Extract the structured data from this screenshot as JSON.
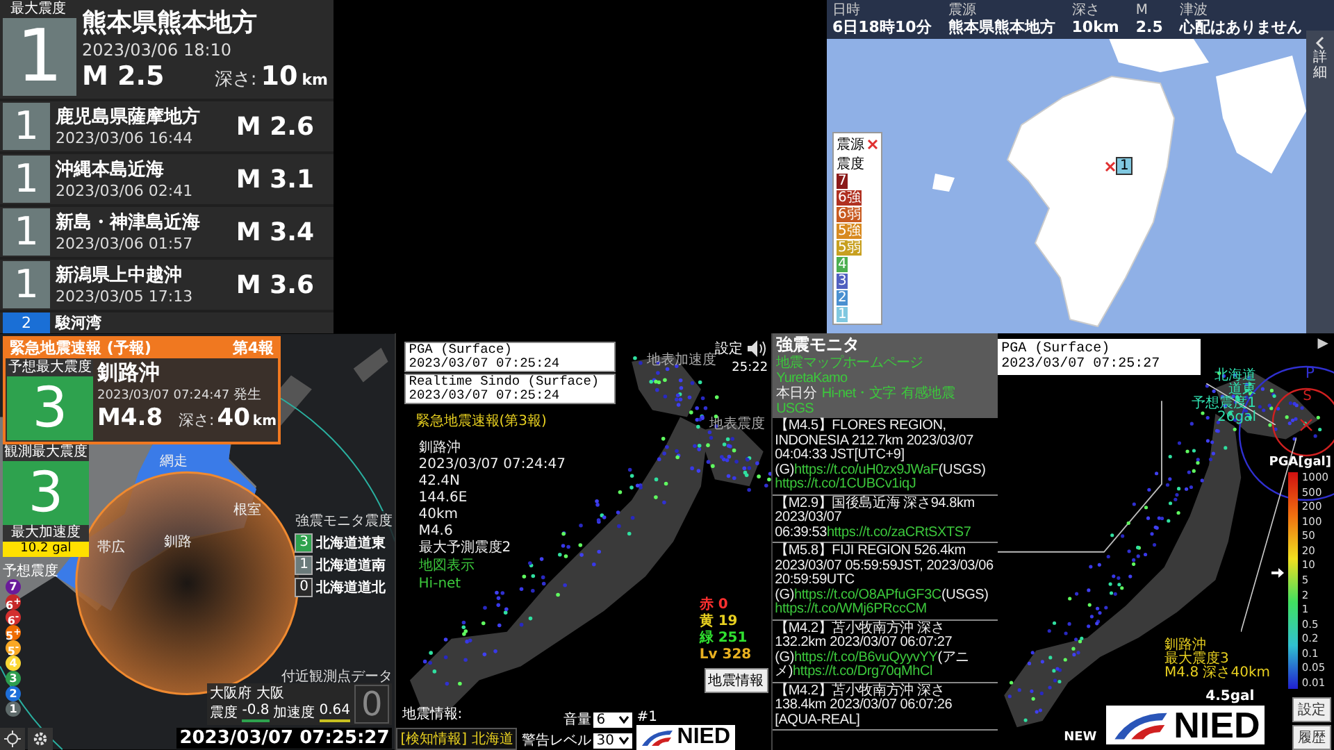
{
  "latest_list": {
    "max_label": "最大震度",
    "main": {
      "intensity": "1",
      "color": "#6b7b7b",
      "region": "熊本県熊本地方",
      "time": "2023/03/06  18:10",
      "magnitude": "M 2.5",
      "depth_label": "深さ:",
      "depth": "10",
      "depth_unit": "km"
    },
    "items": [
      {
        "intensity": "1",
        "color": "#6b7b7b",
        "region": "鹿児島県薩摩地方",
        "time": "2023/03/06  16:44",
        "magnitude": "M 2.6"
      },
      {
        "intensity": "1",
        "color": "#6b7b7b",
        "region": "沖縄本島近海",
        "time": "2023/03/06  02:41",
        "magnitude": "M 3.1"
      },
      {
        "intensity": "1",
        "color": "#6b7b7b",
        "region": "新島・神津島近海",
        "time": "2023/03/06  01:57",
        "magnitude": "M 3.4"
      },
      {
        "intensity": "1",
        "color": "#6b7b7b",
        "region": "新潟県上中越沖",
        "time": "2023/03/05  17:13",
        "magnitude": "M 3.6"
      }
    ],
    "partial": {
      "intensity": "2",
      "color": "#1a6fd6",
      "region": "駿河湾"
    }
  },
  "map_info": {
    "fields": [
      {
        "label": "日時",
        "value": "6日18時10分"
      },
      {
        "label": "震源",
        "value": "熊本県熊本地方"
      },
      {
        "label": "深さ",
        "value": "10km"
      },
      {
        "label": "M",
        "value": "2.5"
      },
      {
        "label": "津波",
        "value": "心配はありません"
      }
    ],
    "detail_tab": "詳細",
    "marker": "1",
    "legend": {
      "epicenter_label": "震源",
      "intensity_label": "震度",
      "levels": [
        {
          "label": "7",
          "color": "#8b1a1a"
        },
        {
          "label": "6強",
          "color": "#b03020"
        },
        {
          "label": "6弱",
          "color": "#c85a20"
        },
        {
          "label": "5強",
          "color": "#d88a20"
        },
        {
          "label": "5弱",
          "color": "#c8a020"
        },
        {
          "label": "4",
          "color": "#4caf50"
        },
        {
          "label": "3",
          "color": "#5060c0"
        },
        {
          "label": "2",
          "color": "#4a90d0"
        },
        {
          "label": "1",
          "color": "#80c8e0"
        }
      ]
    }
  },
  "eew": {
    "header": "緊急地震速報 (予報)",
    "report": "第4報",
    "forecast_label": "予想最大震度",
    "forecast_intensity": "3",
    "region": "釧路沖",
    "time": "2023/03/07 07:24:47",
    "occurred": "発生",
    "magnitude": "M4.8",
    "depth_label": "深さ:",
    "depth": "40",
    "depth_unit": "km",
    "observed_label": "観測最大震度",
    "observed_intensity": "3",
    "accel_label": "最大加速度",
    "accel": "10.2 gal",
    "scale_label": "予想震度",
    "scale": [
      {
        "label": "7",
        "color": "#6a1b9a"
      },
      {
        "label": "6$^{+}$",
        "color": "#c62828"
      },
      {
        "label": "6$^{-}$",
        "color": "#d32f2f"
      },
      {
        "label": "5$^{+}$",
        "color": "#ef6c00"
      },
      {
        "label": "5$^{-}$",
        "color": "#f9a825"
      },
      {
        "label": "4",
        "color": "#fdd835"
      },
      {
        "label": "3",
        "color": "#2e9e4f"
      },
      {
        "label": "2",
        "color": "#1e6fd9"
      },
      {
        "label": "1",
        "color": "#5f6b6b"
      }
    ],
    "place_labels": [
      "網走",
      "根室",
      "釧路",
      "帯広"
    ],
    "monitor_label": "強震モニタ震度",
    "monitor": [
      {
        "intensity": "3",
        "color": "#2ea24e",
        "area": "北海道道東"
      },
      {
        "intensity": "1",
        "color": "#6b7b7b",
        "area": "北海道道南"
      },
      {
        "intensity": "0",
        "color": "#2a2a2a",
        "area": "北海道道北"
      }
    ],
    "nearby_label": "付近観測点データ",
    "nearby_station": "大阪府 大阪",
    "nearby_intensity_label": "震度",
    "nearby_intensity": "-0.8",
    "nearby_accel_label": "加速度",
    "nearby_accel": "0.64",
    "nearby_big": "0",
    "clock": "2023/03/07 07:25:27"
  },
  "kmoni": {
    "pga_title": "PGA (Surface)",
    "pga_time": "2023/03/07 07:25:24",
    "sindo_title": "Realtime Sindo (Surface)",
    "sindo_time": "2023/03/07 07:25:24",
    "eew_title": "緊急地震速報(第3報)",
    "eew_lines": [
      "釧路沖",
      "2023/03/07 07:24:47",
      "42.4N",
      "144.6E",
      "40km",
      "M4.6",
      "最大予測震度2"
    ],
    "map_toggle": "地図表示",
    "hinet_toggle": "Hi-net",
    "accel_label": "地表加速度",
    "sindo_label": "地表震度",
    "settings": "設定",
    "time": "25:22",
    "counts": [
      {
        "label": "赤",
        "value": "0",
        "color": "#ff3030"
      },
      {
        "label": "黄",
        "value": "19",
        "color": "#e8d020"
      },
      {
        "label": "緑",
        "value": "251",
        "color": "#30e030"
      },
      {
        "label": "Lv",
        "value": "328",
        "color": "#e8b020"
      }
    ],
    "channel": "#1",
    "volume_label": "音量",
    "volume": "6",
    "warn_label": "警告レベル",
    "warn": "30",
    "quake_info_label": "地震情報:",
    "detect_info": "[検知情報] 北海道",
    "logo": "NIED",
    "quake_info_button": "地震情報"
  },
  "feed": {
    "title": "強震モニタ",
    "links_row1": [
      "地震マップホームページ",
      "YuretaKamo"
    ],
    "today_label": "本日分",
    "links_row2": [
      "Hi-net・文字",
      "有感地震",
      "USGS"
    ],
    "entries": [
      {
        "segments": [
          {
            "kind": "text",
            "text": "【M4.5】FLORES REGION, INDONESIA 212.7km 2023/03/07 04:04:33 JST[UTC+9] (G)"
          },
          {
            "kind": "link",
            "text": "https://t.co/uH0zx9JWaF"
          },
          {
            "kind": "text",
            "text": "(USGS)"
          },
          {
            "kind": "link",
            "text": "https://t.co/1CUBCv1iqJ"
          }
        ]
      },
      {
        "segments": [
          {
            "kind": "text",
            "text": "【M2.9】国後島近海 深さ94.8km 2023/03/07 06:39:53"
          },
          {
            "kind": "link",
            "text": "https://t.co/zaCRtSXTS7"
          }
        ]
      },
      {
        "segments": [
          {
            "kind": "text",
            "text": "【M5.8】FIJI REGION 526.4km 2023/03/07 05:59:59JST, 2023/03/06 20:59:59UTC (G)"
          },
          {
            "kind": "link",
            "text": "https://t.co/O8APfuGF3C"
          },
          {
            "kind": "text",
            "text": "(USGS)"
          },
          {
            "kind": "link",
            "text": "https://t.co/WMj6PRccCM"
          }
        ]
      },
      {
        "segments": [
          {
            "kind": "text",
            "text": "【M4.2】苫小牧南方沖 深さ132.2km 2023/03/07 06:07:27 (G)"
          },
          {
            "kind": "link",
            "text": "https://t.co/B6vuQyyvYY"
          },
          {
            "kind": "text",
            "text": "(アニメ)"
          },
          {
            "kind": "link",
            "text": "https://t.co/Drg70qMhCl"
          }
        ]
      },
      {
        "segments": [
          {
            "kind": "text",
            "text": "【M4.2】苫小牧南方沖 深さ138.4km 2023/03/07 06:07:26 [AQUA-REAL]"
          }
        ]
      }
    ]
  },
  "pga": {
    "title": "PGA (Surface)",
    "time": "2023/03/07 07:25:27",
    "play": "▶",
    "region_callout": [
      "北海道",
      "道東",
      "予想震度1",
      "26gal"
    ],
    "p_label": "P",
    "s_label": "S",
    "scale": {
      "title": "PGA[gal]",
      "labels": [
        "1000",
        "500",
        "200",
        "100",
        "50",
        "20",
        "10",
        "5",
        "2",
        "1",
        "0.5",
        "0.2",
        "0.1",
        "0.05",
        "0.01"
      ],
      "level": 0.53
    },
    "eew_callout": [
      "釧路沖",
      "最大震度3",
      "M4.8 深さ40km"
    ],
    "reading": "4.5gal",
    "new_label": "NEW",
    "logo": "NIED",
    "buttons": [
      "設定",
      "履歴"
    ]
  }
}
